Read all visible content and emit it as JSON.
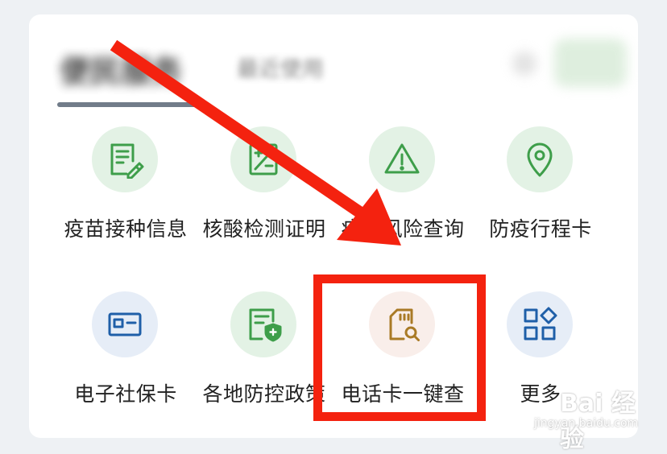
{
  "header": {
    "tab_active": "便民服务",
    "tab_recent": "最近使用"
  },
  "services": [
    {
      "label": "疫苗接种信息",
      "icon": "vaccine-record-icon"
    },
    {
      "label": "核酸检测证明",
      "icon": "test-certificate-icon"
    },
    {
      "label": "疫情风险查询",
      "icon": "warning-triangle-icon"
    },
    {
      "label": "防疫行程卡",
      "icon": "location-pin-icon"
    },
    {
      "label": "电子社保卡",
      "icon": "id-card-icon"
    },
    {
      "label": "各地防控政策",
      "icon": "shield-document-icon"
    },
    {
      "label": "电话卡一键查",
      "icon": "sim-card-search-icon"
    },
    {
      "label": "更多",
      "icon": "apps-grid-icon"
    }
  ],
  "watermark": {
    "main": "Bai 经验",
    "sub": "jingyan.baidu.com"
  },
  "colors": {
    "green_icon": "#3e9e4a",
    "blue_icon": "#1f5fa8",
    "gold_icon": "#a97a26",
    "annotation_red": "#f4220f"
  }
}
